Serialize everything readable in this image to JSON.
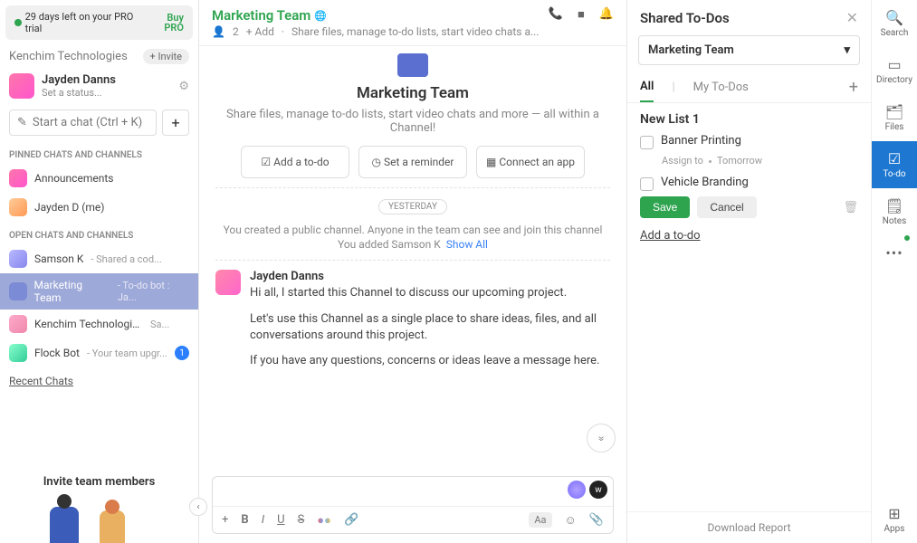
{
  "trial": {
    "dot": "●",
    "text": "29 days left on your PRO trial",
    "buy": "Buy PRO"
  },
  "org": {
    "name": "Kenchim Technologies",
    "invite": "+ Invite"
  },
  "user": {
    "name": "Jayden Danns",
    "status": "Set a status..."
  },
  "startChat": {
    "placeholder": "Start a chat (Ctrl + K)"
  },
  "sections": {
    "pinned": "PINNED CHATS AND CHANNELS",
    "open": "OPEN CHATS AND CHANNELS"
  },
  "pinned": [
    {
      "label": "Announcements"
    },
    {
      "label": "Jayden D (me)"
    }
  ],
  "open": [
    {
      "label": "Samson K",
      "sub": "- Shared a cod..."
    },
    {
      "label": "Marketing Team",
      "sub": "- To-do bot : Ja..."
    },
    {
      "label": "Kenchim Technologies Hub",
      "sub": "Sa..."
    },
    {
      "label": "Flock Bot",
      "sub": "- Your team upgr...",
      "badge": "1"
    }
  ],
  "recent": "Recent Chats",
  "inviteTeam": "Invite team members",
  "channel": {
    "title": "Marketing Team",
    "members": "2",
    "addMember": "+ Add",
    "desc": "Share files, manage to-do lists, start video chats a...",
    "bigDesc": "Share files, manage to-do lists, start video chats and more — all within a Channel!",
    "actions": {
      "todo": "Add a to-do",
      "reminder": "Set a reminder",
      "connect": "Connect an app"
    },
    "dividerLabel": "YESTERDAY",
    "sys1": "You created a public channel. Anyone in the team can see and join this channel",
    "sys2_a": "You added Samson K",
    "sys2_b": "Show All",
    "msg": {
      "author": "Jayden Danns",
      "p1": "Hi all, I started this Channel to discuss our upcoming project.",
      "p2": "Let's use this Channel as a single place to share ideas, files, and all conversations around this project.",
      "p3": "If you have any questions, concerns or ideas leave a message here."
    }
  },
  "todos": {
    "panelTitle": "Shared To-Dos",
    "teamSelect": "Marketing Team",
    "tabAll": "All",
    "tabMy": "My To-Dos",
    "listName": "New List 1",
    "items": [
      {
        "text": "Banner Printing",
        "assign": "Assign to",
        "due": "Tomorrow"
      },
      {
        "text": "Vehicle Branding"
      }
    ],
    "save": "Save",
    "cancel": "Cancel",
    "addTodo": "Add a to-do",
    "download": "Download Report"
  },
  "rail": {
    "search": "Search",
    "directory": "Directory",
    "files": "Files",
    "todo": "To-do",
    "notes": "Notes",
    "apps": "Apps"
  },
  "glyph": {
    "members": "👤",
    "globe": "🌐",
    "phone": "📞",
    "video": "■",
    "bell": "🔔",
    "gear": "⚙",
    "pencil": "✎",
    "plus": "+",
    "chevronDown": "▾",
    "close": "✕",
    "chevLeft": "‹",
    "chevDouble": "»",
    "checkbox": "☑",
    "clock": "◷",
    "grid": "▦",
    "trash": "🗑",
    "search": "🔍",
    "book": "▭",
    "files": "🗂",
    "check": "☑",
    "note": "🗒",
    "apps": "⊞",
    "dots": "•••",
    "bold": "B",
    "italic": "I",
    "underline": "U",
    "strike": "S",
    "color": "●",
    "link": "🔗",
    "aa": "Aa",
    "emoji": "☺",
    "attach": "📎"
  }
}
